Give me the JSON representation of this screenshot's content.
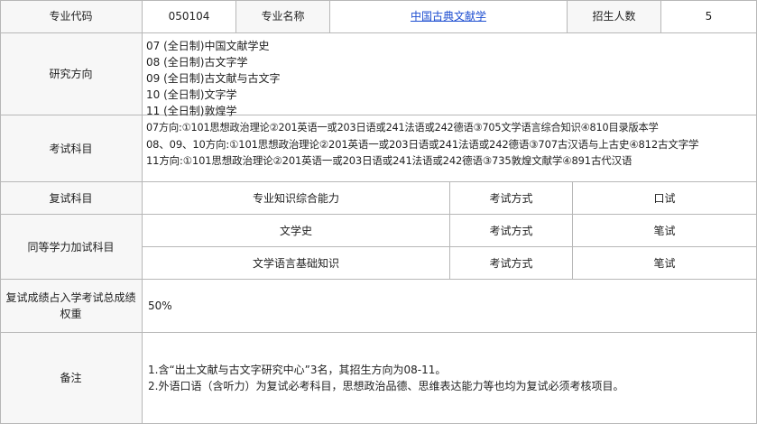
{
  "row1": {
    "code_label": "专业代码",
    "code_value": "050104",
    "name_label": "专业名称",
    "name_value": "中国古典文献学",
    "enroll_label": "招生人数",
    "enroll_value": "5"
  },
  "directions": {
    "label": "研究方向",
    "items": [
      "07 (全日制)中国文献学史",
      "08 (全日制)古文字学",
      "09 (全日制)古文献与古文字",
      "10 (全日制)文字学",
      "11 (全日制)敦煌学"
    ]
  },
  "exam": {
    "label": "考试科目",
    "lines": [
      "07方向:①101思想政治理论②201英语一或203日语或241法语或242德语③705文学语言综合知识④810目录版本学",
      "08、09、10方向:①101思想政治理论②201英语一或203日语或241法语或242德语③707古汉语与上古史④812古文字学",
      "11方向:①101思想政治理论②201英语一或203日语或241法语或242德语③735敦煌文献学④891古代汉语"
    ]
  },
  "retest": {
    "label": "复试科目",
    "subject": "专业知识综合能力",
    "method_label": "考试方式",
    "method_value": "口试"
  },
  "equivalent": {
    "label": "同等学力加试科目",
    "rows": [
      {
        "subject": "文学史",
        "method_label": "考试方式",
        "method_value": "笔试"
      },
      {
        "subject": "文学语言基础知识",
        "method_label": "考试方式",
        "method_value": "笔试"
      }
    ]
  },
  "weight": {
    "label": "复试成绩占入学考试总成绩权重",
    "value": "50%"
  },
  "notes": {
    "label": "备注",
    "lines": [
      "1.含“出土文献与古文字研究中心”3名，其招生方向为08-11。",
      "2.外语口语（含听力）为复试必考科目，思想政治品德、思维表达能力等也均为复试必须考核项目。"
    ]
  }
}
